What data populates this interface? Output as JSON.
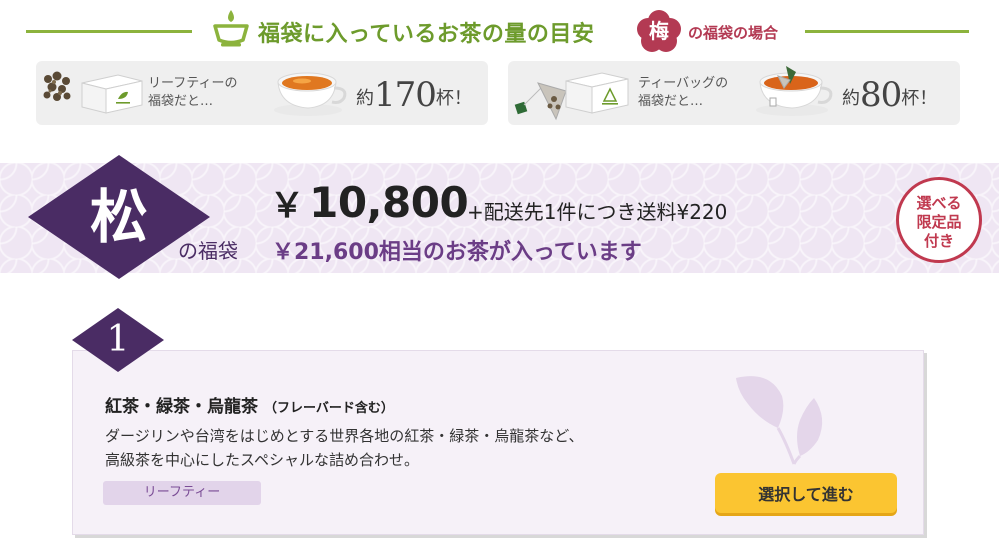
{
  "guide": {
    "title": "福袋に入っているお茶の量の目安",
    "case_glyph": "梅",
    "case_label": "の福袋の場合",
    "icons": [
      "teacup-icon",
      "ume-flower-icon"
    ],
    "accent_color": "#6d9b2c",
    "ume_color": "#b33a53"
  },
  "cards": {
    "leaf": {
      "label": "リーフティーの\n福袋だと…",
      "prefix": "約",
      "number": "170",
      "suffix": "杯！"
    },
    "bag": {
      "label": "ティーバッグの\n福袋だと…",
      "prefix": "約",
      "number": "80",
      "suffix": "杯！"
    }
  },
  "plan": {
    "name_glyph": "松",
    "name_suffix": "の福袋",
    "price_yen": "￥",
    "price_value": "10,800",
    "shipping": "+配送先1件につき送料¥220",
    "worth": "￥21,600相当のお茶が入っています",
    "badge": "選べる\n限定品\n付き",
    "plan_color": "#4a2c64",
    "badge_color": "#c0394f"
  },
  "option": {
    "step": "1",
    "title": "紅茶・緑茶・烏龍茶",
    "title_sub": "（フレーバード含む）",
    "description": "ダージリンや台湾をはじめとする世界各地の紅茶・緑茶・烏龍茶など、\n高級茶を中心にしたスペシャルな詰め合わせ。",
    "tag": "リーフティー",
    "button_label": "選択して進む",
    "button_color": "#fbc531"
  }
}
